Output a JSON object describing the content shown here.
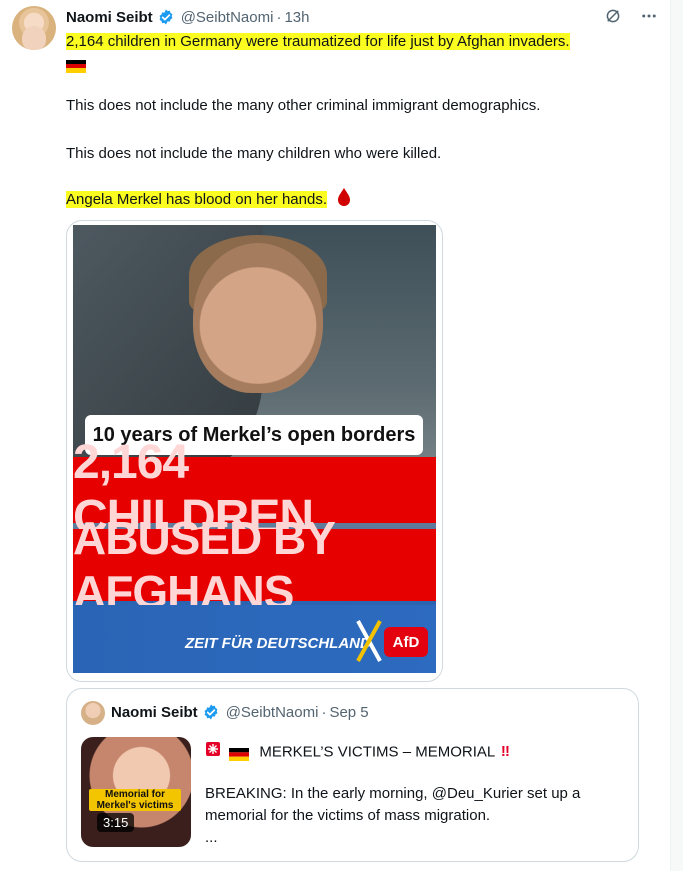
{
  "tweet": {
    "author_name": "Naomi Seibt",
    "handle": "@SeibtNaomi",
    "time": "13h",
    "lines": {
      "l1": "2,164 children in Germany were traumatized for life just by Afghan invaders.",
      "l2": "This does not include the many other criminal immigrant demographics.",
      "l3": "This does not include the many children who were killed.",
      "l4": "Angela Merkel has blood on her hands."
    },
    "media": {
      "tag_text": "10 years of Merkel’s open borders",
      "red_line_1": "2,164 CHILDREN",
      "red_line_2": "ABUSED BY AFGHANS",
      "slogan": "ZEIT FÜR DEUTSCHLAND.",
      "logo": "AfD"
    }
  },
  "quoted": {
    "author_name": "Naomi Seibt",
    "handle": "@SeibtNaomi",
    "date": "Sep 5",
    "title": "MERKEL’S VICTIMS – MEMORIAL",
    "body1": "BREAKING: In the early morning, @Deu_Kurier set up a",
    "body2": "memorial for the victims of mass migration.",
    "ellipsis": "...",
    "thumb_label": "Memorial for Merkel's victims",
    "duration": "3:15"
  },
  "colors": {
    "verified": "#1d9bf0",
    "highlight": "#fbfc20",
    "red": "#e60000",
    "blue": "#2a64b5"
  },
  "icons": [
    "verified-badge-icon",
    "grok-icon",
    "more-icon",
    "german-flag-icon",
    "blood-drop-icon",
    "siren-icon",
    "double-exclamation-icon"
  ]
}
